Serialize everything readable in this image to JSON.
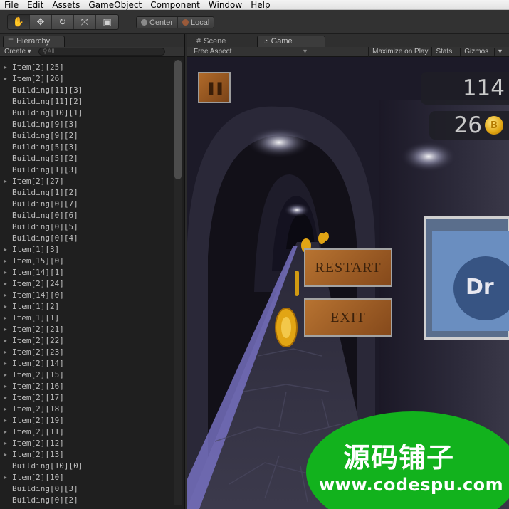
{
  "menu": {
    "items": [
      "File",
      "Edit",
      "Assets",
      "GameObject",
      "Component",
      "Window",
      "Help"
    ]
  },
  "toolbar": {
    "tools": [
      {
        "name": "hand-tool",
        "glyph": "✋",
        "active": true
      },
      {
        "name": "move-tool",
        "glyph": "✥",
        "active": false
      },
      {
        "name": "rotate-tool",
        "glyph": "↻",
        "active": false
      },
      {
        "name": "scale-tool",
        "glyph": "⤧",
        "active": false
      },
      {
        "name": "rect-tool",
        "glyph": "▣",
        "active": false
      }
    ],
    "pivot_center": "Center",
    "pivot_local": "Local"
  },
  "hierarchy": {
    "tab_label": "Hierarchy",
    "create_label": "Create",
    "search_placeholder": "All",
    "items": [
      {
        "label": "Item[2][25]",
        "expandable": true
      },
      {
        "label": "Item[2][26]",
        "expandable": true
      },
      {
        "label": "Building[11][3]",
        "expandable": false
      },
      {
        "label": "Building[11][2]",
        "expandable": false
      },
      {
        "label": "Building[10][1]",
        "expandable": false
      },
      {
        "label": "Building[9][3]",
        "expandable": false
      },
      {
        "label": "Building[9][2]",
        "expandable": false
      },
      {
        "label": "Building[5][3]",
        "expandable": false
      },
      {
        "label": "Building[5][2]",
        "expandable": false
      },
      {
        "label": "Building[1][3]",
        "expandable": false
      },
      {
        "label": "Item[2][27]",
        "expandable": true
      },
      {
        "label": "Building[1][2]",
        "expandable": false
      },
      {
        "label": "Building[0][7]",
        "expandable": false
      },
      {
        "label": "Building[0][6]",
        "expandable": false
      },
      {
        "label": "Building[0][5]",
        "expandable": false
      },
      {
        "label": "Building[0][4]",
        "expandable": false
      },
      {
        "label": "Item[1][3]",
        "expandable": true
      },
      {
        "label": "Item[15][0]",
        "expandable": true
      },
      {
        "label": "Item[14][1]",
        "expandable": true
      },
      {
        "label": "Item[2][24]",
        "expandable": true
      },
      {
        "label": "Item[14][0]",
        "expandable": true
      },
      {
        "label": "Item[1][2]",
        "expandable": true
      },
      {
        "label": "Item[1][1]",
        "expandable": true
      },
      {
        "label": "Item[2][21]",
        "expandable": true
      },
      {
        "label": "Item[2][22]",
        "expandable": true
      },
      {
        "label": "Item[2][23]",
        "expandable": true
      },
      {
        "label": "Item[2][14]",
        "expandable": true
      },
      {
        "label": "Item[2][15]",
        "expandable": true
      },
      {
        "label": "Item[2][16]",
        "expandable": true
      },
      {
        "label": "Item[2][17]",
        "expandable": true
      },
      {
        "label": "Item[2][18]",
        "expandable": true
      },
      {
        "label": "Item[2][19]",
        "expandable": true
      },
      {
        "label": "Item[2][11]",
        "expandable": true
      },
      {
        "label": "Item[2][12]",
        "expandable": true
      },
      {
        "label": "Item[2][13]",
        "expandable": true
      },
      {
        "label": "Building[10][0]",
        "expandable": false
      },
      {
        "label": "Item[2][10]",
        "expandable": true
      },
      {
        "label": "Building[0][3]",
        "expandable": false
      },
      {
        "label": "Building[0][2]",
        "expandable": false
      }
    ],
    "scroll_position": 0
  },
  "view_tabs": {
    "scene_label": "Scene",
    "game_label": "Game"
  },
  "gamebar": {
    "aspect": "Free Aspect",
    "maximize": "Maximize on Play",
    "stats": "Stats",
    "gizmos": "Gizmos"
  },
  "game": {
    "score": "114",
    "coins": "26",
    "coin_symbol": "B",
    "restart_label": "RESTART",
    "exit_label": "EXIT",
    "billboard_text": "Dr"
  },
  "watermark": {
    "title": "源码铺子",
    "url": "www.codespu.com"
  },
  "colors": {
    "watermark_green": "#12b21d",
    "button_wood": "#b06a2a",
    "coin_gold": "#e0a512"
  }
}
